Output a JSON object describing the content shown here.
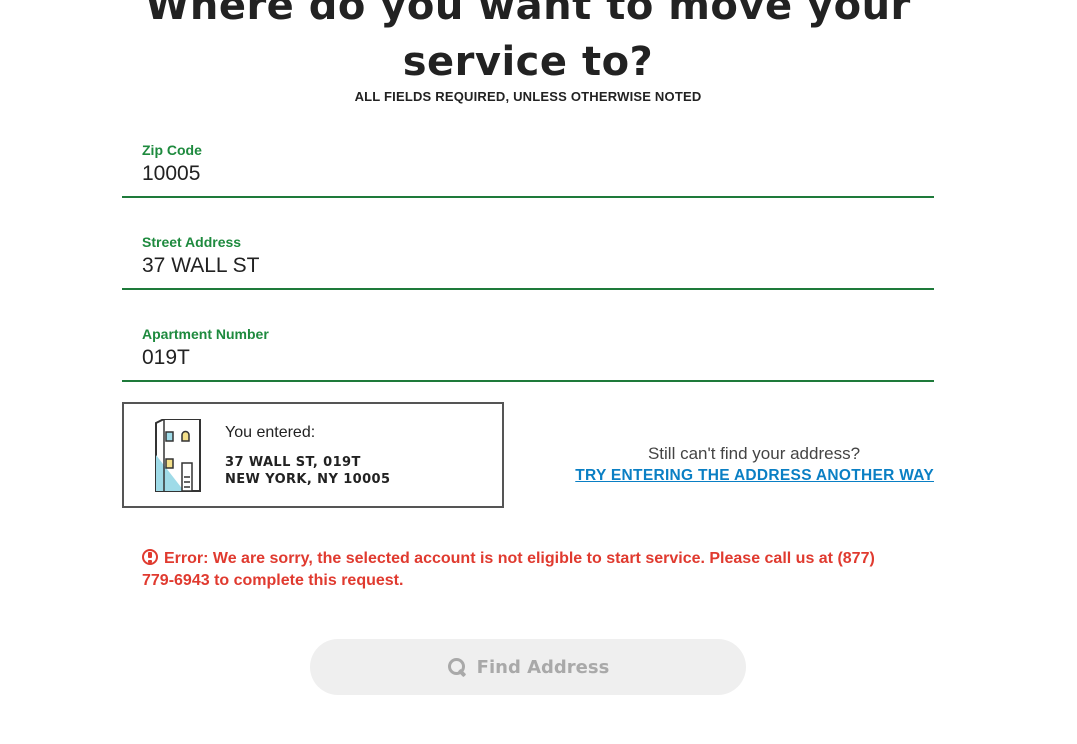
{
  "heading": {
    "line1": "Where do you want to move your",
    "line2": "service to?",
    "subtitle": "ALL FIELDS REQUIRED, UNLESS OTHERWISE NOTED"
  },
  "form": {
    "zip": {
      "label": "Zip Code",
      "value": "10005"
    },
    "street": {
      "label": "Street Address",
      "value": "37 WALL ST"
    },
    "apartment": {
      "label": "Apartment Number",
      "value": "019T"
    }
  },
  "entered": {
    "label": "You entered:",
    "line1": "37 WALL ST, 019T",
    "line2": "NEW YORK, NY 10005",
    "icon": "building-icon"
  },
  "help": {
    "text": "Still can't find your address?",
    "link": "TRY ENTERING THE ADDRESS ANOTHER WAY"
  },
  "error": {
    "message": "Error: We are sorry, the selected account is not eligible to start service. Please call us at (877) 779-6943 to complete this request."
  },
  "button": {
    "find_label": "Find Address",
    "icon": "search-icon"
  },
  "colors": {
    "accent_green": "#1e8a3e",
    "link_blue": "#0a7fc4",
    "error_red": "#e03a2f",
    "button_bg": "#efefef",
    "button_text": "#a9a9a9"
  }
}
